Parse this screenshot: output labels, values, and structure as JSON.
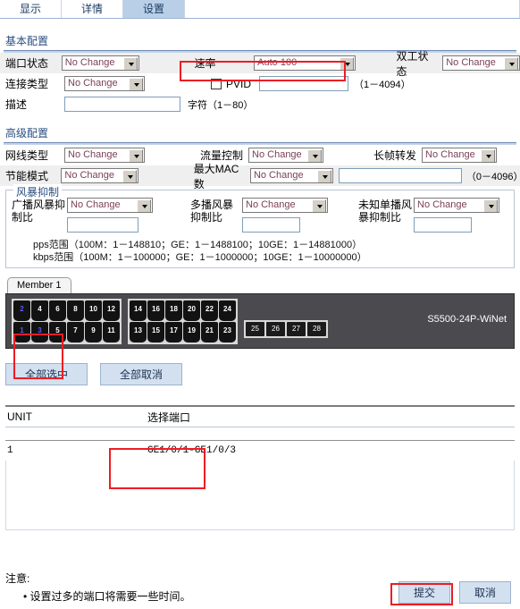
{
  "tabs": [
    {
      "label": "显示",
      "active": false
    },
    {
      "label": "详情",
      "active": false
    },
    {
      "label": "设置",
      "active": true
    }
  ],
  "basic": {
    "title": "基本配置",
    "port_state": {
      "label": "端口状态",
      "value": "No Change"
    },
    "speed": {
      "label": "速率",
      "value": "Auto 100"
    },
    "duplex": {
      "label": "双工状态",
      "value": "No Change"
    },
    "link_type": {
      "label": "连接类型",
      "value": "No Change"
    },
    "pvid": {
      "label": "PVID",
      "value": "",
      "checked": false,
      "range": "（1－4094）"
    },
    "description": {
      "label": "描述",
      "value": "",
      "hint": "字符（1－80）"
    }
  },
  "advanced": {
    "title": "高级配置",
    "cable_type": {
      "label": "网线类型",
      "value": "No Change"
    },
    "flow_control": {
      "label": "流量控制",
      "value": "No Change"
    },
    "jumbo_frame": {
      "label": "长帧转发",
      "value": "No Change"
    },
    "power_save": {
      "label": "节能模式",
      "value": "No Change"
    },
    "max_mac": {
      "label": "最大MAC数",
      "value": "No Change",
      "input": "",
      "range": "（0－4096）"
    }
  },
  "storm": {
    "title": "风暴抑制",
    "broadcast": {
      "label": "广播风暴抑制比",
      "value": "No Change",
      "input": ""
    },
    "multicast": {
      "label": "多播风暴抑制比",
      "value": "No Change",
      "input": ""
    },
    "unknown_unicast": {
      "label": "未知单播风暴抑制比",
      "value": "No Change",
      "input": ""
    },
    "pps_range": "pps范围（100M：1－148810；GE：1－1488100；10GE：1－14881000）",
    "kbps_range": "kbps范围（100M：1－100000；GE：1－1000000；10GE：1－10000000）"
  },
  "device": {
    "member_tab": "Member 1",
    "model": "S5500-24P-WiNet",
    "ports_top": [
      "2",
      "4",
      "6",
      "8",
      "10",
      "12",
      "14",
      "16",
      "18",
      "20",
      "22",
      "24"
    ],
    "ports_bottom": [
      "1",
      "3",
      "5",
      "7",
      "9",
      "11",
      "13",
      "15",
      "17",
      "19",
      "21",
      "23"
    ],
    "sfp_ports": [
      "25",
      "26",
      "27",
      "28"
    ],
    "selected_ports": [
      "1",
      "2",
      "3"
    ]
  },
  "selection_buttons": {
    "select_all": "全部选中",
    "deselect_all": "全部取消"
  },
  "result_table": {
    "headers": [
      "UNIT",
      "选择端口"
    ],
    "rows": [
      {
        "unit": "1",
        "ports": "GE1/0/1-GE1/0/3"
      }
    ]
  },
  "footer": {
    "note_title": "注意:",
    "note_items": [
      "设置过多的端口将需要一些时间。"
    ],
    "submit": "提交",
    "cancel": "取消"
  },
  "colors": {
    "highlight": "#ee1c24",
    "tab_active": "#b9cfe8",
    "select_text": "#7b3f55",
    "panel": "#4a4a4f",
    "port_selected": "#5b5bff"
  }
}
